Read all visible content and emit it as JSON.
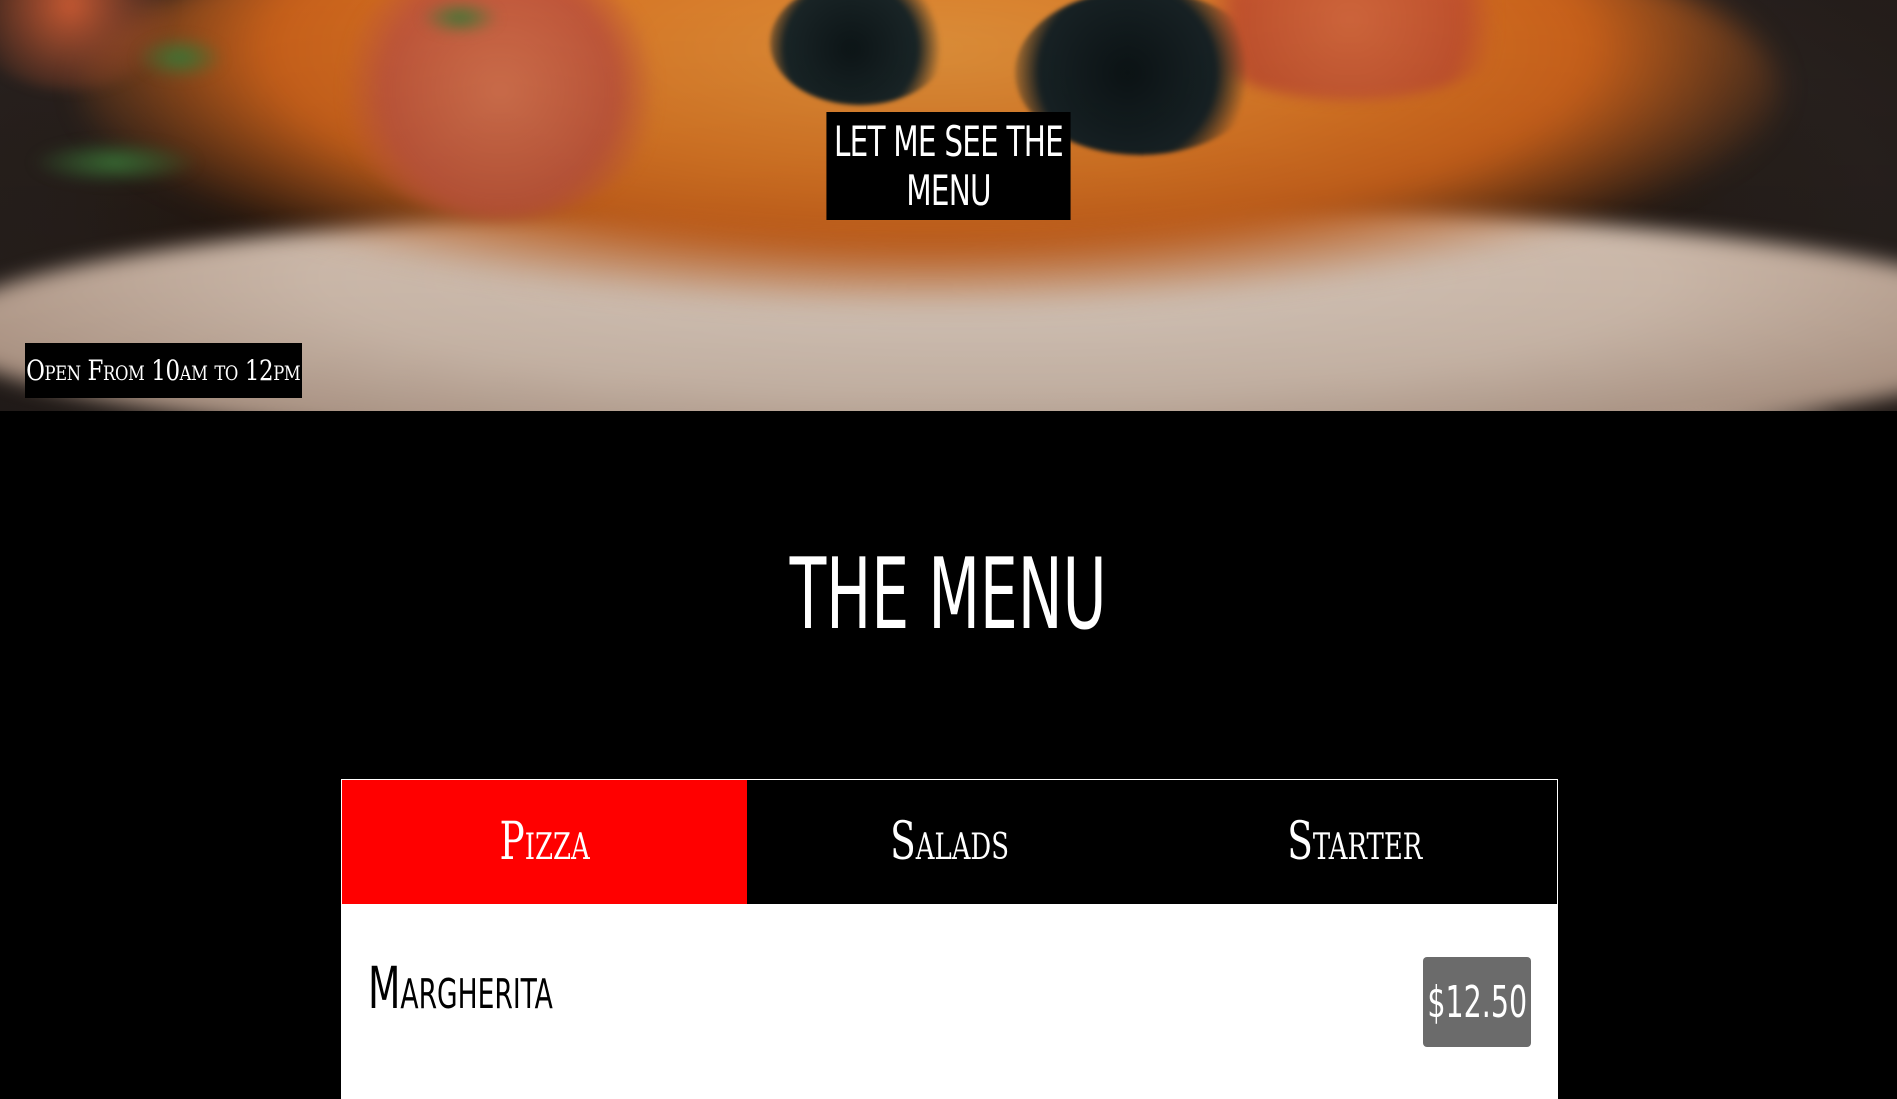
{
  "hero": {
    "cta_label": "Let me see the menu",
    "hours_text": "Open From 10am to 12pm"
  },
  "menu": {
    "title": "The Menu",
    "tabs": [
      {
        "label": "Pizza",
        "active": true
      },
      {
        "label": "Salads",
        "active": false
      },
      {
        "label": "Starter",
        "active": false
      }
    ],
    "items": [
      {
        "name": "Margherita",
        "price": "$12.50"
      }
    ]
  },
  "colors": {
    "active_tab": "#ff0000",
    "price_badge": "#6b6b6b",
    "background": "#000000"
  }
}
